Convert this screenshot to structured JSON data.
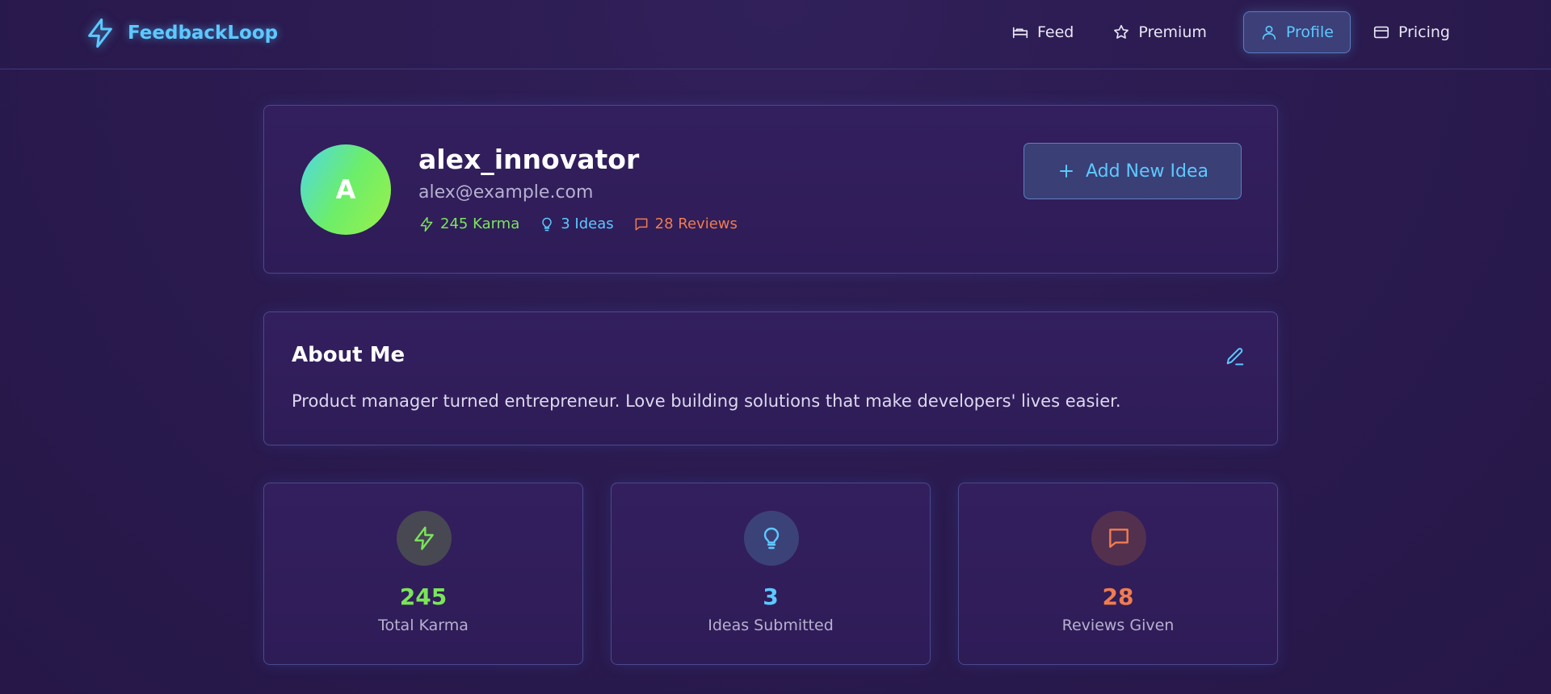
{
  "brand": {
    "name": "FeedbackLoop",
    "icon": "bolt-icon",
    "color": "#5cc9ff"
  },
  "nav": {
    "items": [
      {
        "label": "Feed",
        "icon": "bed-icon",
        "active": false
      },
      {
        "label": "Premium",
        "icon": "star-icon",
        "active": false
      },
      {
        "label": "Profile",
        "icon": "user-icon",
        "active": true
      },
      {
        "label": "Pricing",
        "icon": "card-icon",
        "active": false
      }
    ]
  },
  "profile": {
    "avatar_initial": "A",
    "username": "alex_innovator",
    "email": "alex@example.com",
    "stats": {
      "karma": "245 Karma",
      "ideas": "3 Ideas",
      "reviews": "28 Reviews"
    },
    "add_button_label": "Add New Idea"
  },
  "about": {
    "title": "About Me",
    "text": "Product manager turned entrepreneur. Love building solutions that make developers' lives easier."
  },
  "stat_cards": [
    {
      "value": "245",
      "label": "Total Karma",
      "icon": "bolt-icon",
      "color": "#7be55a"
    },
    {
      "value": "3",
      "label": "Ideas Submitted",
      "icon": "lightbulb-icon",
      "color": "#5cc9ff"
    },
    {
      "value": "28",
      "label": "Reviews Given",
      "icon": "message-icon",
      "color": "#f07c4f"
    }
  ],
  "colors": {
    "background": "#2a1a4e",
    "card": "#331f5e",
    "border": "#4a4a8e",
    "accent": "#5cc9ff",
    "green": "#7be55a",
    "orange": "#f07c4f"
  }
}
